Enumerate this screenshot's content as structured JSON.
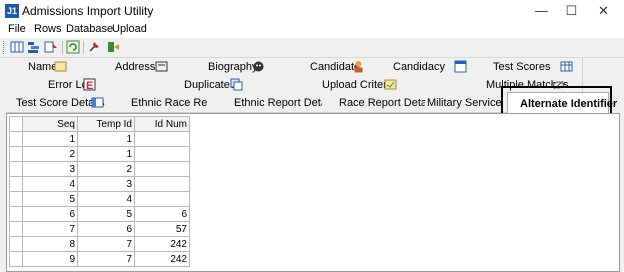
{
  "window": {
    "title": "Admissions Import Utility",
    "icon": "J1"
  },
  "controls": {
    "minimize": "—",
    "maximize": "☐",
    "close": "✕"
  },
  "menu": [
    "File",
    "Rows",
    "Database",
    "Upload"
  ],
  "toolbar": {
    "icons": [
      "columns-icon",
      "sort-icon",
      "filter-icon",
      "refresh-icon",
      "pin-icon",
      "exit-icon"
    ]
  },
  "tabs": {
    "row1": [
      "Name",
      "Address",
      "Biography",
      "Candidate",
      "Candidacy",
      "Test Scores"
    ],
    "row2": [
      "Error Log",
      "Duplicates",
      "Upload Criteria",
      "Multiple Matches"
    ],
    "row3": [
      "Test Score Details",
      "Ethnic Race Report",
      "Ethnic Report Detail",
      "Race Report Detail",
      "Military Service",
      "Alternate Identifier"
    ]
  },
  "table": {
    "columns": [
      "Seq",
      "Temp Id",
      "Id Num"
    ],
    "rows": [
      [
        "1",
        "1",
        ""
      ],
      [
        "2",
        "1",
        ""
      ],
      [
        "3",
        "2",
        ""
      ],
      [
        "4",
        "3",
        ""
      ],
      [
        "5",
        "4",
        ""
      ],
      [
        "6",
        "5",
        "6"
      ],
      [
        "7",
        "6",
        "57"
      ],
      [
        "8",
        "7",
        "242"
      ],
      [
        "9",
        "7",
        "242"
      ]
    ]
  }
}
